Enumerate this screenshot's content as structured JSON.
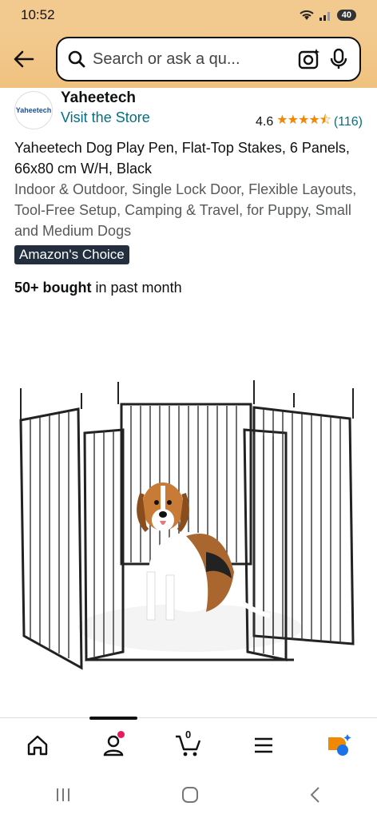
{
  "status": {
    "time": "10:52",
    "battery": "40"
  },
  "search": {
    "placeholder": "Search or ask a qu..."
  },
  "store": {
    "logo_text": "Yaheetech",
    "brand": "Yaheetech",
    "visit": "Visit the Store",
    "rating": "4.6",
    "stars": "★★★★⯪",
    "count": "(116)"
  },
  "product": {
    "title": "Yaheetech Dog Play Pen, Flat-Top Stakes, 6 Panels, 66x80 cm W/H, Black",
    "subtitle": "Indoor & Outdoor, Single Lock Door, Flexible Layouts, Tool-Free Setup, Camping & Travel, for Puppy, Small and Medium Dogs",
    "badge": "Amazon's Choice",
    "bought_bold": "50+ bought",
    "bought_rest": " in past month"
  },
  "nav": {
    "cart_count": "0"
  },
  "colors": {
    "header": "#f2c98f",
    "link": "#007185",
    "star": "#f08804",
    "badge": "#232f3e"
  }
}
